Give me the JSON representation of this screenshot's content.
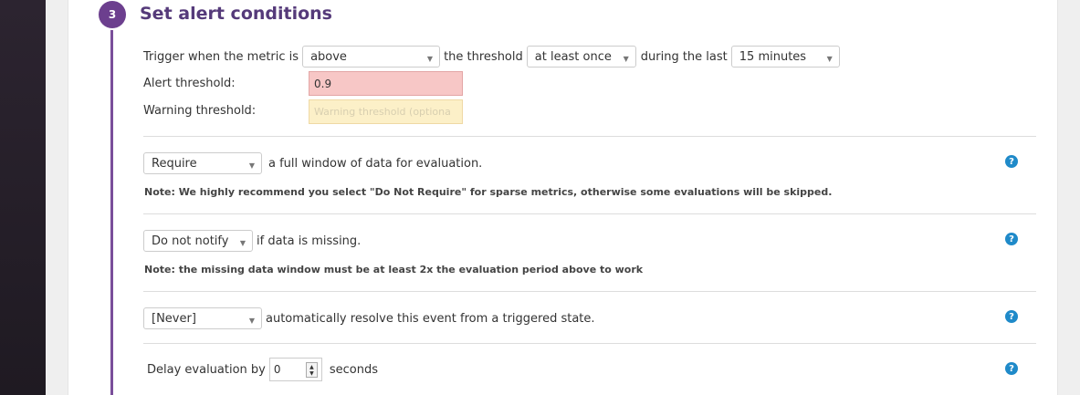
{
  "step": {
    "number": "3",
    "title": "Set alert conditions"
  },
  "trigger": {
    "prefix": "Trigger when the metric is",
    "condition_value": "above",
    "mid_text": "the threshold",
    "frequency_value": "at least once",
    "during_text": "during the last",
    "window_value": "15 minutes"
  },
  "alert_threshold": {
    "label": "Alert threshold:",
    "value": "0.9"
  },
  "warning_threshold": {
    "label": "Warning threshold:",
    "placeholder": "Warning threshold (optiona"
  },
  "full_window": {
    "select_value": "Require",
    "text": "a full window of data for evaluation.",
    "note": "Note: We highly recommend you select \"Do Not Require\" for sparse metrics, otherwise some evaluations will be skipped."
  },
  "missing_data": {
    "select_value": "Do not notify",
    "text": "if data is missing.",
    "note": "Note: the missing data window must be at least 2x the evaluation period above to work"
  },
  "auto_resolve": {
    "select_value": "[Never]",
    "text": "automatically resolve this event from a triggered state."
  },
  "delay": {
    "label": "Delay evaluation by",
    "value": "0",
    "unit": "seconds"
  },
  "help_glyph": "?",
  "caret_glyph": "▼",
  "colors": {
    "step_purple": "#6c3f8e",
    "title_purple": "#553a7a",
    "alert_bg": "#f7c7c6",
    "warning_bg": "#fcf0c8",
    "help_blue": "#1f8ac9"
  }
}
